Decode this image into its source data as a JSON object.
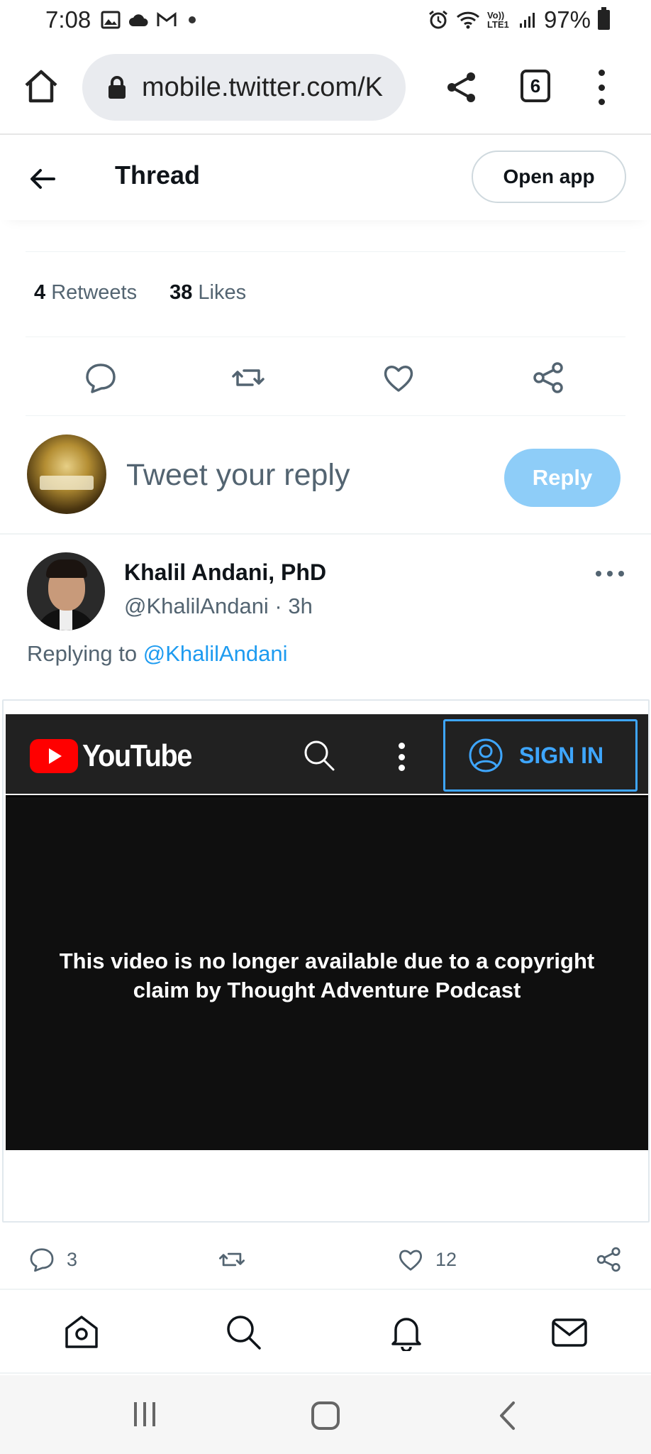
{
  "status_bar": {
    "time": "7:08",
    "battery": "97%",
    "icons": [
      "gallery-icon",
      "cloud-icon",
      "gmail-icon",
      "alarm-icon",
      "wifi-icon",
      "volte-icon",
      "signal-icon",
      "battery-icon"
    ],
    "network_label": "Vo)) LTE1"
  },
  "browser": {
    "url": "mobile.twitter.com/K",
    "tab_count": "6"
  },
  "thread_header": {
    "title": "Thread",
    "open_app_label": "Open app"
  },
  "stats": {
    "retweets_count": "4",
    "retweets_label": "Retweets",
    "likes_count": "38",
    "likes_label": "Likes"
  },
  "composer": {
    "placeholder": "Tweet your reply",
    "reply_label": "Reply"
  },
  "tweet": {
    "name": "Khalil Andani, PhD",
    "handle_time": "@KhalilAndani · 3h",
    "replying_prefix": "Replying to",
    "replying_mention": "@KhalilAndani",
    "reply_count": "3",
    "like_count": "12"
  },
  "youtube_embed": {
    "brand": "YouTube",
    "sign_in_label": "SIGN IN",
    "message": "This video is no longer available due to a copyright claim by Thought Adventure Podcast"
  },
  "colors": {
    "twitter_blue": "#1d9bf0",
    "reply_button": "#8ecdf8",
    "youtube_red": "#ff0000",
    "youtube_signin_blue": "#3ea6ff"
  }
}
